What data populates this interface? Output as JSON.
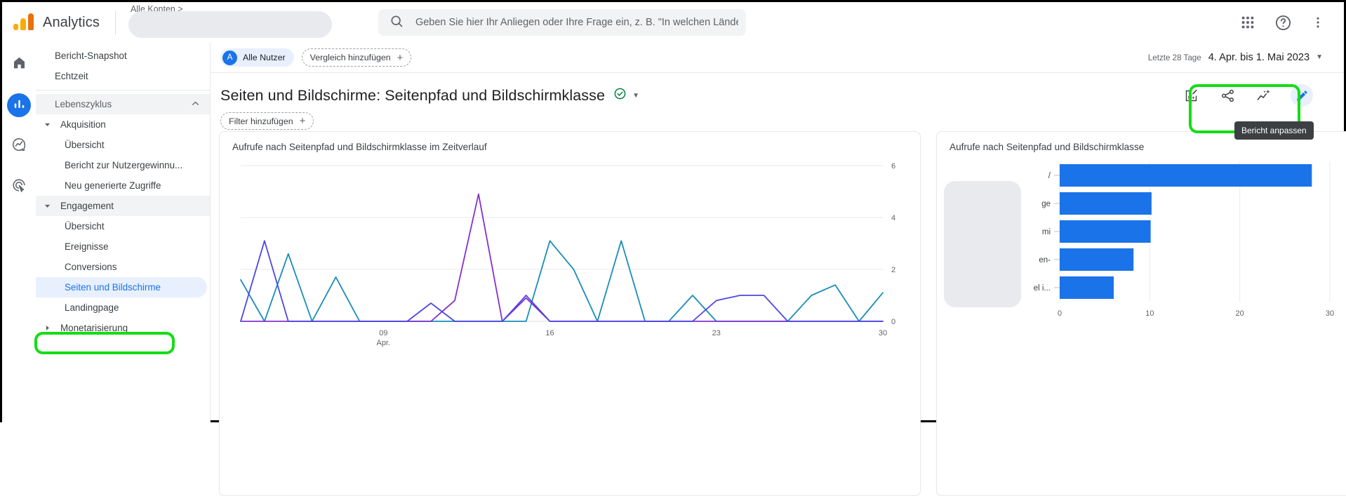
{
  "topbar": {
    "brand": "Analytics",
    "logo_icon": "analytics-logo-icon",
    "account_breadcrumb": "Alle Konten > ",
    "search_placeholder": "Geben Sie hier Ihr Anliegen oder Ihre Frage ein, z. B. \"In welchen Ländern ...",
    "search_icon": "search-icon",
    "apps_icon": "apps-grid-icon",
    "help_icon": "help-circle-icon",
    "more_icon": "more-vertical-icon"
  },
  "rail": {
    "items": [
      {
        "icon": "home-icon",
        "name": "home",
        "active": false
      },
      {
        "icon": "reports-bar-chart-icon",
        "name": "reports",
        "active": true
      },
      {
        "icon": "explore-trend-icon",
        "name": "explore",
        "active": false
      },
      {
        "icon": "advertising-target-icon",
        "name": "advertising",
        "active": false
      }
    ]
  },
  "sidebar": {
    "items": [
      {
        "label": "Bericht-Snapshot",
        "level": 1,
        "type": "item"
      },
      {
        "label": "Echtzeit",
        "level": 1,
        "type": "item"
      },
      {
        "label": "Lebenszyklus",
        "level": 1,
        "type": "group-header",
        "expanded": true
      },
      {
        "label": "Akquisition",
        "level": 1,
        "type": "section",
        "expanded": true
      },
      {
        "label": "Übersicht",
        "level": 2,
        "type": "item"
      },
      {
        "label": "Bericht zur Nutzergewinnu...",
        "level": 2,
        "type": "item"
      },
      {
        "label": "Neu generierte Zugriffe",
        "level": 2,
        "type": "item"
      },
      {
        "label": "Engagement",
        "level": 1,
        "type": "section",
        "expanded": true,
        "highlighted": true
      },
      {
        "label": "Übersicht",
        "level": 2,
        "type": "item"
      },
      {
        "label": "Ereignisse",
        "level": 2,
        "type": "item"
      },
      {
        "label": "Conversions",
        "level": 2,
        "type": "item"
      },
      {
        "label": "Seiten und Bildschirme",
        "level": 2,
        "type": "item",
        "selected": true
      },
      {
        "label": "Landingpage",
        "level": 2,
        "type": "item"
      },
      {
        "label": "Monetarisierung",
        "level": 1,
        "type": "section",
        "expanded": false
      }
    ]
  },
  "comparison": {
    "all_users_avatar": "A",
    "all_users_label": "Alle Nutzer",
    "add_comparison_label": "Vergleich hinzufügen",
    "add_icon": "plus-icon"
  },
  "date_range": {
    "preset_label": "Letzte 28 Tage",
    "range_label": "4. Apr. bis 1. Mai 2023",
    "dropdown_icon": "chevron-down-icon"
  },
  "report": {
    "title": "Seiten und Bildschirme: Seitenpfad und Bildschirmklasse",
    "status_icon": "check-circle-icon",
    "status_dropdown_icon": "chevron-down-icon",
    "filter_label": "Filter hinzufügen",
    "filter_add_icon": "plus-icon"
  },
  "toolbar": {
    "edit_chart_icon": "edit-chart-icon",
    "share_icon": "share-icon",
    "insights_icon": "insights-sparkle-icon",
    "customize_icon": "pencil-edit-icon",
    "customize_tooltip": "Bericht anpassen"
  },
  "colors": {
    "accent_blue": "#1a73e8",
    "bar_blue": "#1a73e8",
    "series_teal": "#1a8cb8",
    "series_purple": "#8430ce",
    "series_indigo": "#4f46e5",
    "highlight_green": "#14dd14",
    "logo_yellow": "#F9AB00",
    "logo_orange": "#E8710A"
  },
  "chart_data": [
    {
      "type": "line",
      "title": "Aufrufe nach Seitenpfad und Bildschirmklasse im Zeitverlauf",
      "xlabel": "",
      "ylabel": "",
      "ylim": [
        0,
        6
      ],
      "yticks": [
        0,
        2,
        4,
        6
      ],
      "xticks": [
        "09\nApr.",
        "16",
        "23",
        "30"
      ],
      "xtick_labels": [
        "09",
        "16",
        "23",
        "30"
      ],
      "xtick_sublabel": "Apr.",
      "grid": true,
      "legend": "none",
      "x": [
        1,
        2,
        3,
        4,
        5,
        6,
        7,
        8,
        9,
        10,
        11,
        12,
        13,
        14,
        15,
        16,
        17,
        18,
        19,
        20,
        21,
        22,
        23,
        24,
        25,
        26,
        27,
        28
      ],
      "series": [
        {
          "name": "series-teal",
          "color": "#1a8cb8",
          "values": [
            1.6,
            0,
            2.6,
            0,
            1.7,
            0,
            0,
            0,
            0,
            0,
            0,
            0,
            0,
            3.1,
            2.0,
            0,
            3.1,
            0,
            0,
            1.0,
            0,
            0,
            0,
            0,
            1.0,
            1.4,
            0,
            1.1
          ]
        },
        {
          "name": "series-purple",
          "color": "#8430ce",
          "values": [
            0,
            0,
            0,
            0,
            0,
            0,
            0,
            0,
            0,
            0.8,
            4.9,
            0,
            0.9,
            0,
            0,
            0,
            0,
            0,
            0,
            0,
            0,
            0,
            0,
            0,
            0,
            0,
            0,
            0
          ]
        },
        {
          "name": "series-indigo",
          "color": "#4f46e5",
          "values": [
            0,
            3.1,
            0,
            0,
            0,
            0,
            0,
            0,
            0.7,
            0,
            0,
            0,
            1.0,
            0,
            0,
            0,
            0,
            0,
            0,
            0,
            0.8,
            1.0,
            1.0,
            0,
            0,
            0,
            0,
            0
          ]
        }
      ]
    },
    {
      "type": "bar",
      "orientation": "horizontal",
      "title": "Aufrufe nach Seitenpfad und Bildschirmklasse",
      "xlabel": "",
      "ylabel": "",
      "xlim": [
        0,
        30
      ],
      "xticks": [
        0,
        10,
        20,
        30
      ],
      "grid": true,
      "categories": [
        "/",
        "ge",
        "mi",
        "en-",
        "el i..."
      ],
      "values": [
        28,
        10.2,
        10.1,
        8.2,
        6.0
      ],
      "color": "#1a73e8",
      "note": "category labels partially covered by a gray redaction overlay"
    }
  ]
}
